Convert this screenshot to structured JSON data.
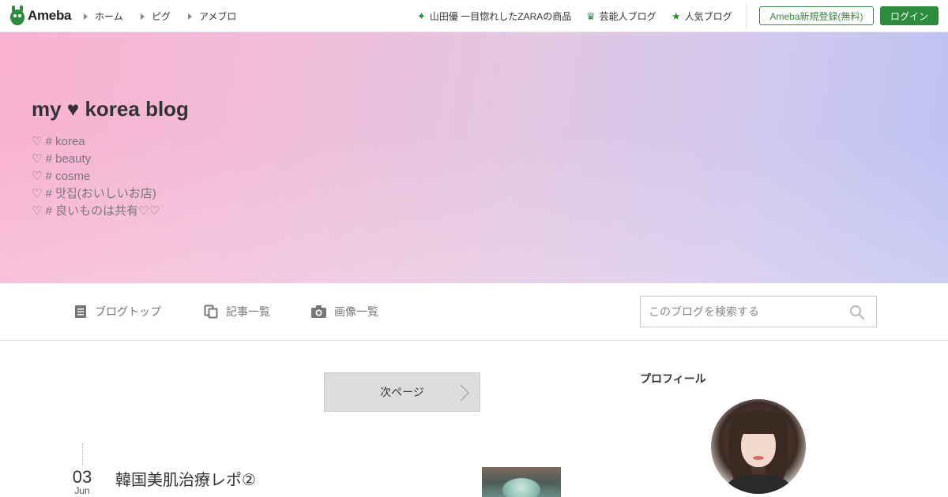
{
  "topbar": {
    "logo_text": "Ameba",
    "nav": [
      {
        "label": "ホーム"
      },
      {
        "label": "ピグ"
      },
      {
        "label": "アメブロ"
      }
    ],
    "links": [
      {
        "label": "山田優 一目惚れしたZARAの商品",
        "icon": "sparkle-icon"
      },
      {
        "label": "芸能人ブログ",
        "icon": "crown-icon"
      },
      {
        "label": "人気ブログ",
        "icon": "star-icon"
      }
    ],
    "register_label": "Ameba新規登録(無料)",
    "login_label": "ログイン",
    "accent_color": "#2d8c3c"
  },
  "header": {
    "title": "my ♥ korea blog",
    "description": [
      "♡ # korea",
      "♡ # beauty",
      "♡ # cosme",
      "♡ # 맛집(おいしいお店)",
      "♡ # 良いものは共有♡♡"
    ]
  },
  "subnav": {
    "items": [
      {
        "label": "ブログトップ",
        "icon": "document-icon"
      },
      {
        "label": "記事一覧",
        "icon": "copy-icon"
      },
      {
        "label": "画像一覧",
        "icon": "camera-icon"
      }
    ],
    "search_placeholder": "このブログを検索する"
  },
  "main": {
    "next_page_label": "次ページ",
    "entry": {
      "day": "03",
      "month": "Jun",
      "title": "韓国美肌治療レポ②"
    }
  },
  "sidebar": {
    "profile_heading": "プロフィール"
  }
}
